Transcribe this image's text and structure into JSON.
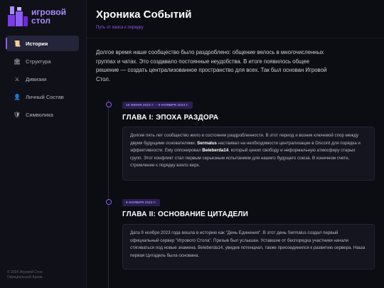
{
  "app": {
    "logo_line1": "игровой",
    "logo_line2": "стол"
  },
  "sidebar": {
    "items": [
      {
        "label": "История",
        "icon": "scroll-icon",
        "active": true
      },
      {
        "label": "Структура",
        "icon": "building-icon",
        "active": false
      },
      {
        "label": "Дивизии",
        "icon": "crossed-swords-icon",
        "active": false
      },
      {
        "label": "Личный Состав",
        "icon": "person-icon",
        "active": false
      },
      {
        "label": "Символика",
        "icon": "shield-icon",
        "active": false
      }
    ],
    "footer_line1": "© 2024 Игровой Стол.",
    "footer_line2": "Официальный Архив."
  },
  "page": {
    "title": "Хроника Событий",
    "subtitle": "Путь от хаоса к порядку",
    "intro": "Долгое время наше сообщество было раздроблено: общение велось в многочисленных группах и чатах. Это создавало постоянные неудобства. В итоге появилось общее решение — создать централизованное пространство для всех. Так был основан Игровой Стол."
  },
  "chapters": [
    {
      "date": "10 ИЮНЯ 2023 Г. – 9 НОЯБРЯ 2023 Г.",
      "title": "ГЛАВА I: ЭПОХА РАЗДОРА",
      "text_1": "Долгие пять лет сообщество жило в состоянии раздробленности. В этот период и возник ключевой спор между двумя будущими основателями. ",
      "name_1": "Sermalus",
      "text_2": " настаивал на необходимости централизации в Discord для порядка и эффективности. Ему оппонировал ",
      "name_2": "Beleberda14",
      "text_3": ", который ценил свободу и неформальную атмосферу старых групп. Этот конфликт стал первым серьезным испытанием для нашего будущего союза. В конечном счете, стремление к порядку взяло верх."
    },
    {
      "date": "9 НОЯБРЯ 2023 Г.",
      "title": "ГЛАВА II: ОСНОВАНИЕ ЦИТАДЕЛИ",
      "text": "Дата 9 ноября 2023 года вошла в историю как \"День Единения\". В этот день Sermalus создал первый официальный сервер \"Игрового Стола\". Призыв был услышан. Уставшие от беспорядка участники начали стягиваться под новые знамена. Beleberda14, увидев потенциал, также присоединился к развитию сервера. Наша первая Цитадель была основана."
    }
  ],
  "colors": {
    "accent": "#8b5cf6",
    "accent_light": "#a78bfa",
    "background": "#0c0c13",
    "sidebar": "#101018",
    "card": "#15151f"
  }
}
